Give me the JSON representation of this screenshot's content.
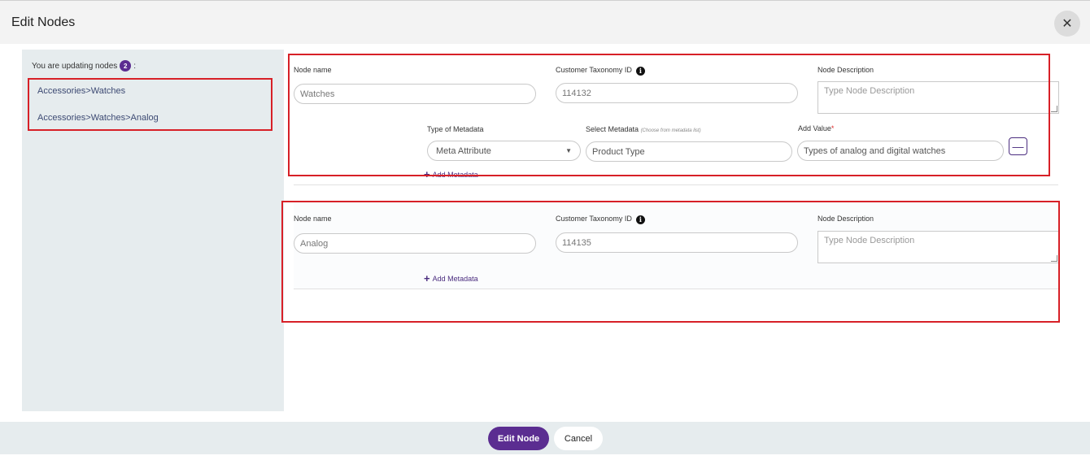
{
  "dialog": {
    "title": "Edit Nodes",
    "close_icon": "close-icon"
  },
  "left_panel": {
    "updating_text": "You are updating nodes",
    "count": "2",
    "suffix": ":",
    "nodes": [
      "Accessories>Watches",
      "Accessories>Watches>Analog"
    ]
  },
  "node1": {
    "name_label": "Node name",
    "name_value": "Watches",
    "taxonomy_label": "Customer Taxonomy ID",
    "taxonomy_value": "114132",
    "description_label": "Node Description",
    "description_placeholder": "Type Node Description",
    "metadata": {
      "type_label": "Type of Metadata",
      "select_label": "Select Metadata",
      "select_hint": "(Choose from metadata list)",
      "value_label": "Add Value",
      "required_mark": "*",
      "type_value": "Meta Attribute",
      "select_value": "Product Type",
      "value_value": "Types of analog and digital watches"
    },
    "add_metadata": "Add Metadata"
  },
  "node2": {
    "name_label": "Node name",
    "name_value": "Analog",
    "taxonomy_label": "Customer Taxonomy ID",
    "taxonomy_value": "114135",
    "description_label": "Node Description",
    "description_placeholder": "Type Node Description",
    "add_metadata": "Add Metadata"
  },
  "footer": {
    "primary": "Edit Node",
    "cancel": "Cancel"
  },
  "colors": {
    "accent": "#5b2d91",
    "highlight": "#d72027",
    "panel": "#e6ecee"
  }
}
